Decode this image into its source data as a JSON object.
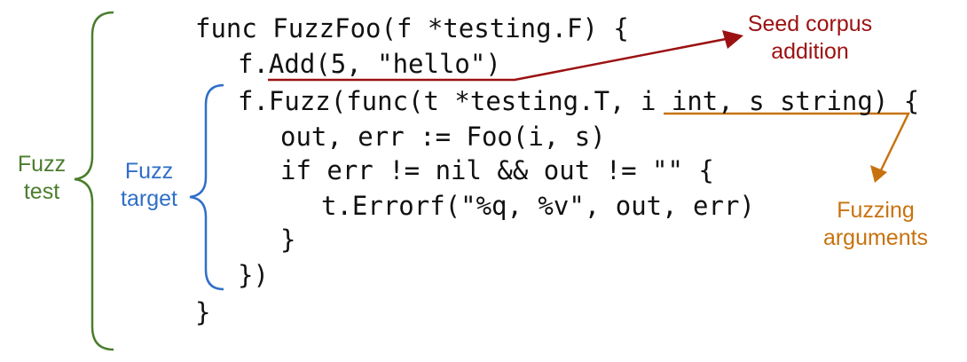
{
  "code": {
    "lines": [
      "func FuzzFoo(f *testing.F) {",
      "f.Add(5, \"hello\")",
      "f.Fuzz(func(t *testing.T, i int, s string) {",
      "out, err := Foo(i, s)",
      "if err != nil && out != \"\" {",
      "t.Errorf(\"%q, %v\", out, err)",
      "}",
      "})",
      "}"
    ]
  },
  "annotations": {
    "fuzz_test": {
      "line1": "Fuzz",
      "line2": "test",
      "color": "#4a7d2c"
    },
    "fuzz_target": {
      "line1": "Fuzz",
      "line2": "target",
      "color": "#2f6fc8"
    },
    "seed_corpus": {
      "line1": "Seed corpus",
      "line2": "addition",
      "color": "#9b1111"
    },
    "fuzzing_arguments": {
      "line1": "Fuzzing",
      "line2": "arguments",
      "color": "#c8720f"
    }
  },
  "colors": {
    "code_text": "#111111",
    "background": "#ffffff"
  }
}
